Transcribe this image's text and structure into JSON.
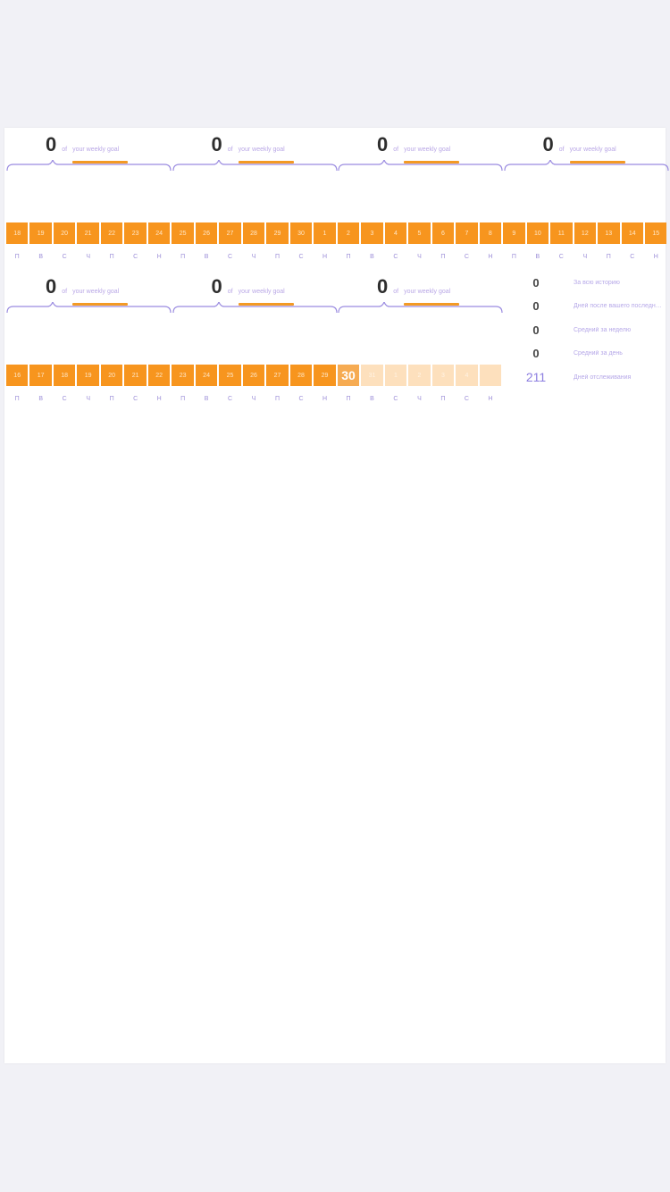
{
  "weekly_goal": {
    "of_text": "of",
    "goal_text": "your weekly goal"
  },
  "row1": {
    "week_counts": [
      "0",
      "0",
      "0",
      "0"
    ],
    "days": [
      {
        "n": "18",
        "state": "done"
      },
      {
        "n": "19",
        "state": "done"
      },
      {
        "n": "20",
        "state": "done"
      },
      {
        "n": "21",
        "state": "done"
      },
      {
        "n": "22",
        "state": "done"
      },
      {
        "n": "23",
        "state": "done"
      },
      {
        "n": "24",
        "state": "done"
      },
      {
        "n": "25",
        "state": "done"
      },
      {
        "n": "26",
        "state": "done"
      },
      {
        "n": "27",
        "state": "done"
      },
      {
        "n": "28",
        "state": "done"
      },
      {
        "n": "29",
        "state": "done"
      },
      {
        "n": "30",
        "state": "done"
      },
      {
        "n": "1",
        "state": "done"
      },
      {
        "n": "2",
        "state": "done"
      },
      {
        "n": "3",
        "state": "done"
      },
      {
        "n": "4",
        "state": "done"
      },
      {
        "n": "5",
        "state": "done"
      },
      {
        "n": "6",
        "state": "done"
      },
      {
        "n": "7",
        "state": "done"
      },
      {
        "n": "8",
        "state": "done"
      },
      {
        "n": "9",
        "state": "done"
      },
      {
        "n": "10",
        "state": "done"
      },
      {
        "n": "11",
        "state": "done"
      },
      {
        "n": "12",
        "state": "done"
      },
      {
        "n": "13",
        "state": "done"
      },
      {
        "n": "14",
        "state": "done"
      },
      {
        "n": "15",
        "state": "done"
      }
    ],
    "weekdays": [
      "П",
      "В",
      "С",
      "Ч",
      "П",
      "С",
      "Н",
      "П",
      "В",
      "С",
      "Ч",
      "П",
      "С",
      "Н",
      "П",
      "В",
      "С",
      "Ч",
      "П",
      "С",
      "Н",
      "П",
      "В",
      "С",
      "Ч",
      "П",
      "С",
      "Н"
    ]
  },
  "row2": {
    "week_counts": [
      "0",
      "0",
      "0"
    ],
    "days": [
      {
        "n": "16",
        "state": "done"
      },
      {
        "n": "17",
        "state": "done"
      },
      {
        "n": "18",
        "state": "done"
      },
      {
        "n": "19",
        "state": "done"
      },
      {
        "n": "20",
        "state": "done"
      },
      {
        "n": "21",
        "state": "done"
      },
      {
        "n": "22",
        "state": "done"
      },
      {
        "n": "23",
        "state": "done"
      },
      {
        "n": "24",
        "state": "done"
      },
      {
        "n": "25",
        "state": "done"
      },
      {
        "n": "26",
        "state": "done"
      },
      {
        "n": "27",
        "state": "done"
      },
      {
        "n": "28",
        "state": "done"
      },
      {
        "n": "29",
        "state": "done"
      },
      {
        "n": "30",
        "state": "today"
      },
      {
        "n": "31",
        "state": "future"
      },
      {
        "n": "1",
        "state": "future"
      },
      {
        "n": "2",
        "state": "future"
      },
      {
        "n": "3",
        "state": "future"
      },
      {
        "n": "4",
        "state": "future"
      },
      {
        "n": "",
        "state": "future"
      }
    ],
    "weekdays": [
      "П",
      "В",
      "С",
      "Ч",
      "П",
      "С",
      "Н",
      "П",
      "В",
      "С",
      "Ч",
      "П",
      "С",
      "Н",
      "П",
      "В",
      "С",
      "Ч",
      "П",
      "С",
      "Н"
    ]
  },
  "stats": [
    {
      "value": "0",
      "label": "За всю историю"
    },
    {
      "value": "0",
      "label": "Дней после вашего последнего"
    },
    {
      "value": "0",
      "label": "Средний за неделю"
    },
    {
      "value": "0",
      "label": "Средний за день"
    },
    {
      "value": "211",
      "label": "Дней отслеживания"
    }
  ],
  "colors": {
    "accent_orange": "#f7951e",
    "accent_purple": "#8c7ee0",
    "bracket": "#9a8be0"
  }
}
